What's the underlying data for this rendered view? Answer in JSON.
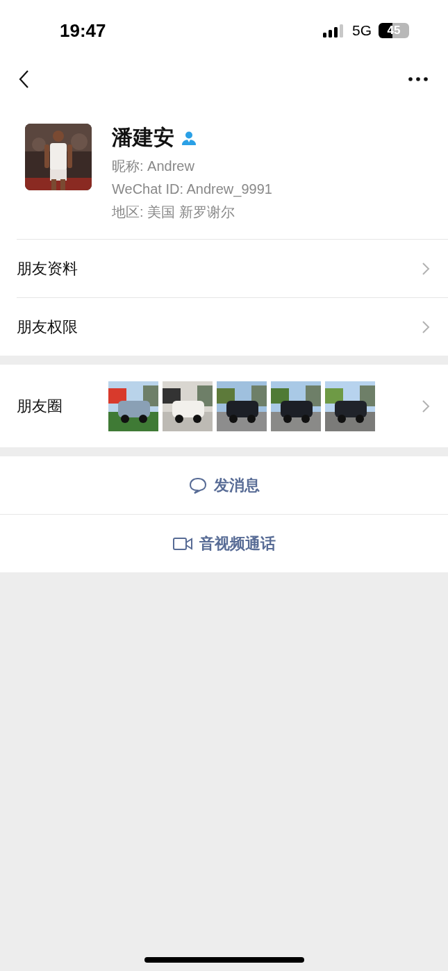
{
  "status_bar": {
    "time": "19:47",
    "network": "5G",
    "battery": {
      "text": "45",
      "level": 0.45
    }
  },
  "profile": {
    "name": "潘建安",
    "nickname": "昵称: Andrew",
    "wechat_id": "WeChat ID: Andrew_9991",
    "region": "地区: 美国 新罗谢尔"
  },
  "menu_items": [
    {
      "label": "朋友资料"
    },
    {
      "label": "朋友权限"
    }
  ],
  "moments": {
    "label": "朋友圈"
  },
  "actions": [
    {
      "kind": "message",
      "label": "发消息"
    },
    {
      "kind": "call",
      "label": "音视频通话"
    }
  ]
}
